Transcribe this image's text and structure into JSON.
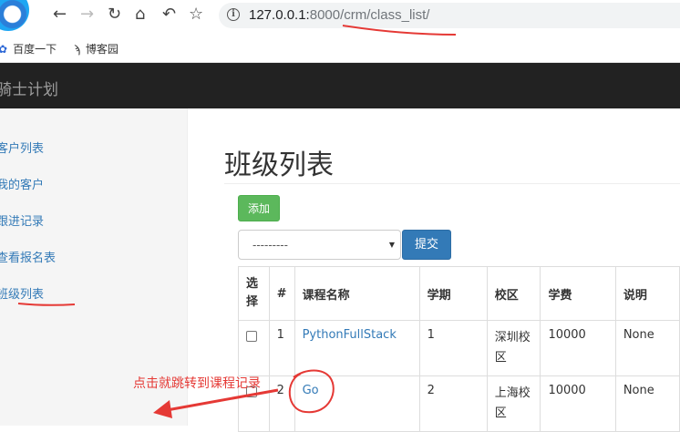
{
  "browser": {
    "url_host": "127.0.0.1:",
    "url_rest": "8000/crm/class_list/",
    "bookmarks": [
      {
        "label": "百度一下",
        "icon": "paw-icon"
      },
      {
        "label": "博客园",
        "icon": "bookmark-icon"
      }
    ]
  },
  "navbar": {
    "brand": "骑士计划"
  },
  "sidebar": {
    "items": [
      {
        "label": "客户列表"
      },
      {
        "label": "我的客户"
      },
      {
        "label": "跟进记录"
      },
      {
        "label": "查看报名表"
      },
      {
        "label": "班级列表"
      }
    ]
  },
  "main": {
    "title": "班级列表",
    "add_button": "添加",
    "select_value": "---------",
    "submit_button": "提交",
    "table": {
      "headers": [
        "选择",
        "#",
        "课程名称",
        "学期",
        "校区",
        "学费",
        "说明"
      ],
      "rows": [
        {
          "index": "1",
          "course": "PythonFullStack",
          "semester": "1",
          "campus": "深圳校区",
          "fee": "10000",
          "note": "None"
        },
        {
          "index": "2",
          "course": "Go",
          "semester": "2",
          "campus": "上海校区",
          "fee": "10000",
          "note": "None"
        }
      ]
    }
  },
  "annotation": {
    "text": "点击就跳转到课程记录",
    "color": "#e53935"
  }
}
